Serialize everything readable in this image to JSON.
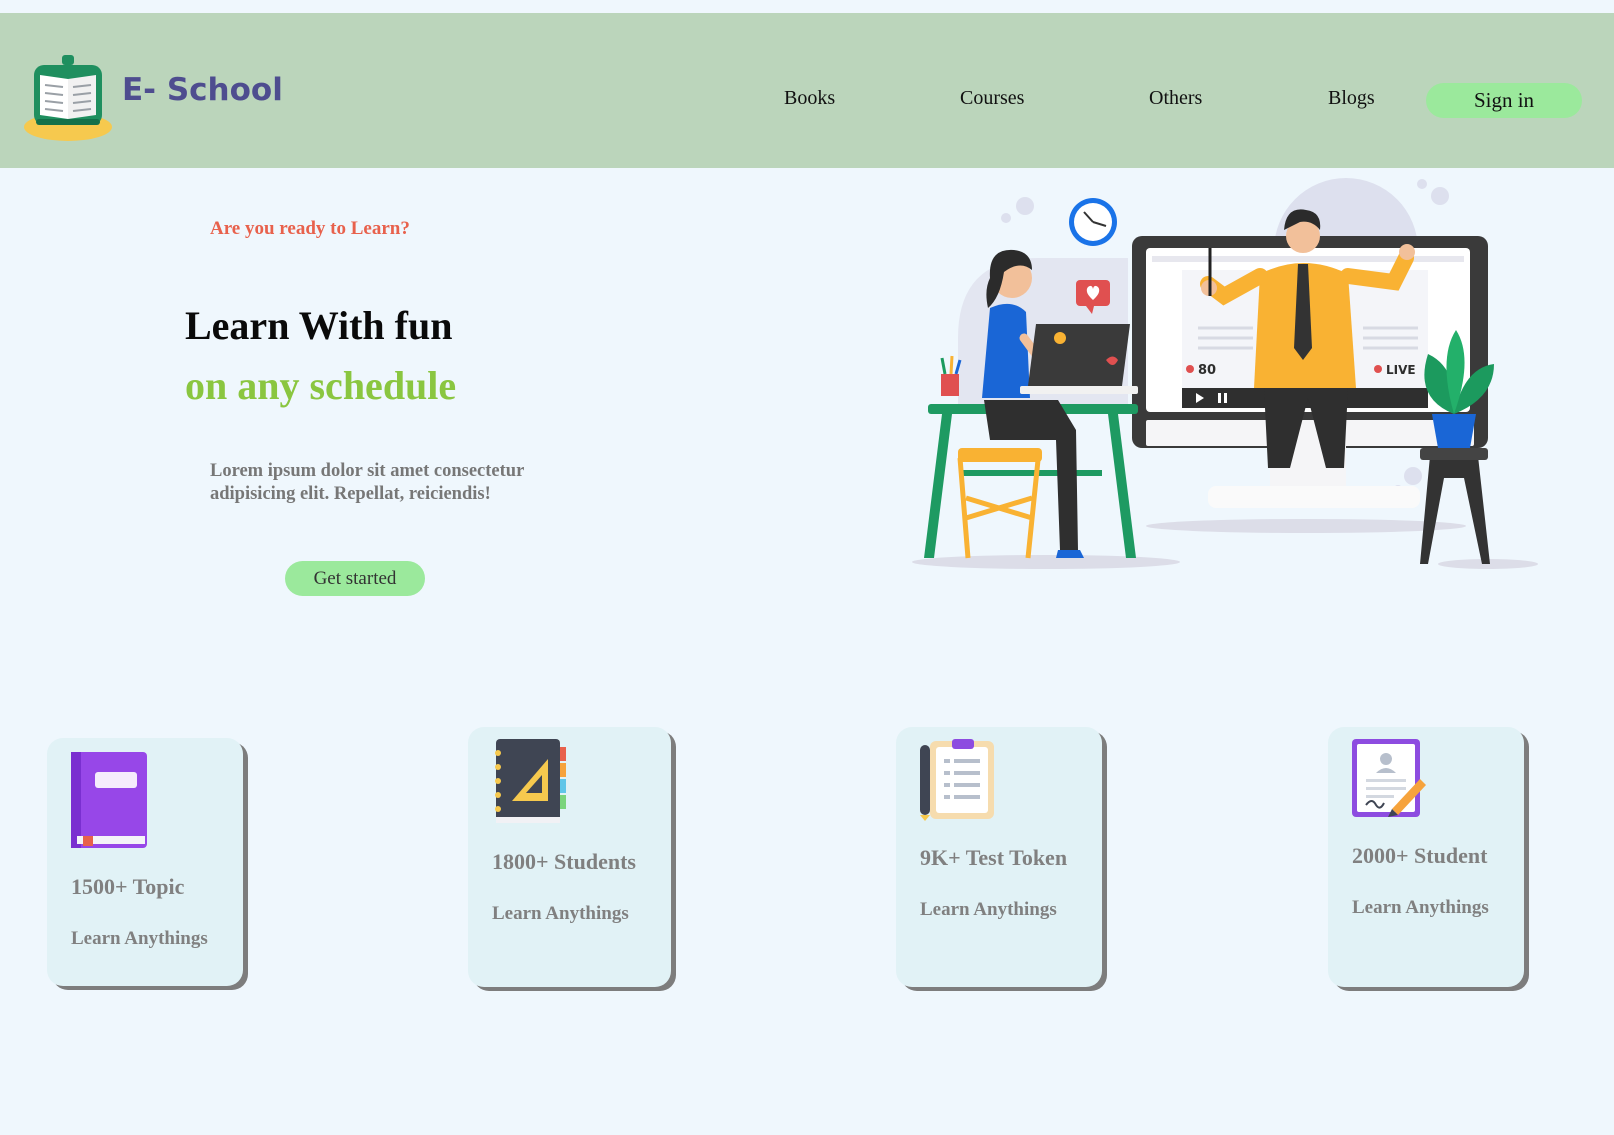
{
  "header": {
    "brand": "E- School",
    "logo_icon": "open-book-icon",
    "nav": [
      "Books",
      "Courses",
      "Others",
      "Blogs"
    ],
    "signin_label": "Sign in"
  },
  "hero": {
    "eyebrow": "Are you ready to Learn?",
    "headline": "Learn With fun",
    "subheadline": "on any schedule",
    "description": "Lorem ipsum dolor sit amet consectetur adipisicing elit. Repellat, reiciendis!",
    "cta_label": "Get started",
    "illustration": {
      "viewer_count": "80",
      "live_label": "LIVE"
    }
  },
  "stats": [
    {
      "value": "1500+ Topic",
      "label": "Learn Anythings",
      "icon": "book-icon"
    },
    {
      "value": "1800+ Students",
      "label": "Learn Anythings",
      "icon": "notebook-icon"
    },
    {
      "value": "9K+ Test Token",
      "label": "Learn Anythings",
      "icon": "clipboard-icon"
    },
    {
      "value": "2000+ Student",
      "label": "Learn Anythings",
      "icon": "certificate-icon"
    }
  ],
  "colors": {
    "page_bg": "#eff7fd",
    "header_bg": "#bbd5bb",
    "button_bg": "#9be99c",
    "accent_red": "#e8614c",
    "accent_green": "#8ac640",
    "brand": "#4e4d8f",
    "card_bg": "#e1f2f6"
  }
}
